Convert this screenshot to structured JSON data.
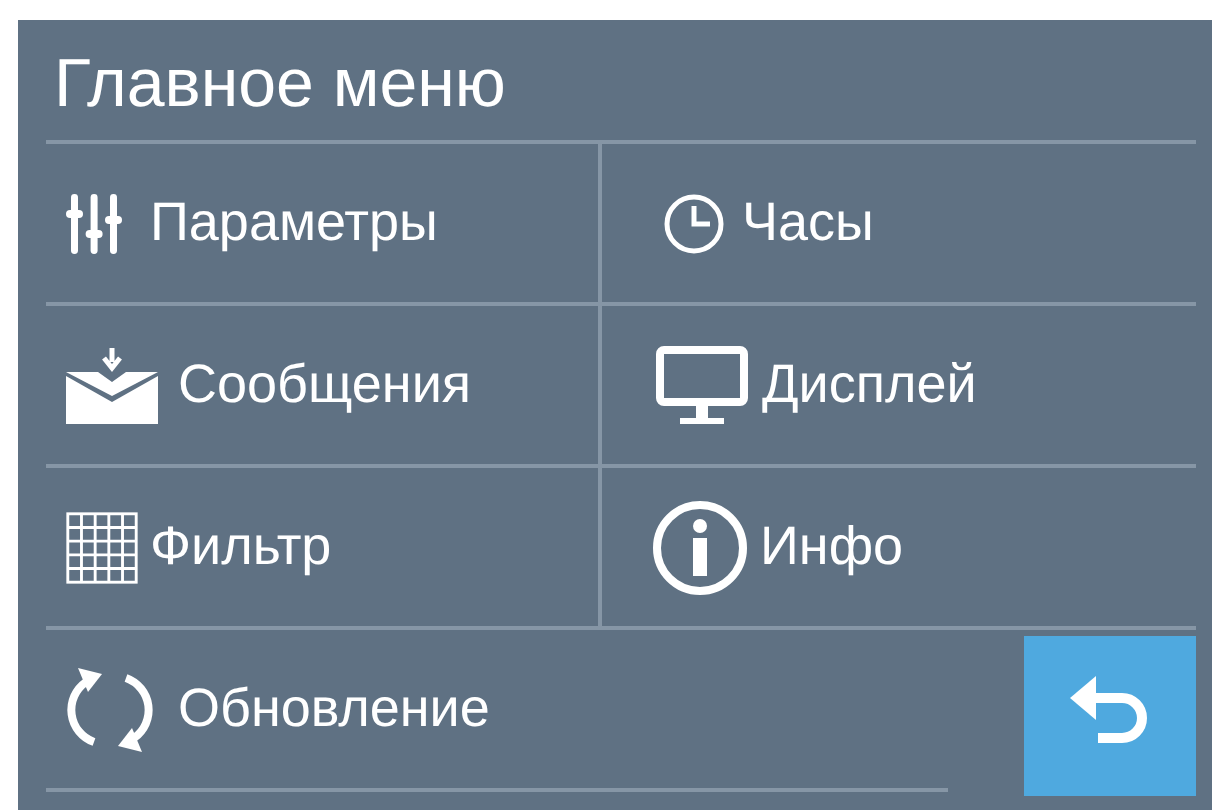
{
  "title": "Главное меню",
  "items": [
    {
      "label": "Параметры",
      "kind": "sliders"
    },
    {
      "label": "Часы",
      "kind": "clock"
    },
    {
      "label": "Сообщения",
      "kind": "mail"
    },
    {
      "label": "Дисплей",
      "kind": "monitor"
    },
    {
      "label": "Фильтр",
      "kind": "grid"
    },
    {
      "label": "Инфо",
      "kind": "info"
    },
    {
      "label": "Обновление",
      "kind": "refresh"
    }
  ]
}
